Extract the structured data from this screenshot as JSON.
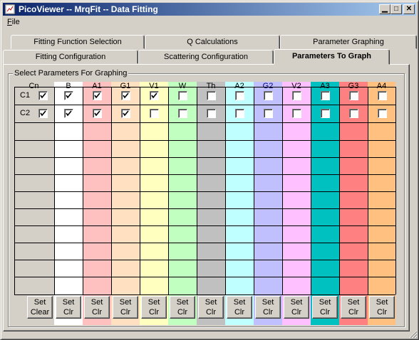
{
  "window": {
    "title": "PicoViewer -- MrqFit -- Data Fitting"
  },
  "menu": {
    "file_label_u": "F",
    "file_label_rest": "ile"
  },
  "tabs": {
    "row1": [
      {
        "label": "Fitting Function Selection"
      },
      {
        "label": "Q  Calculations"
      },
      {
        "label": "Parameter Graphing"
      }
    ],
    "row2": [
      {
        "label": "Fitting Configuration"
      },
      {
        "label": "Scattering Configuration"
      },
      {
        "label": "Parameters To Graph",
        "active": true
      }
    ]
  },
  "frame": {
    "label": "Select Parameters For Graphing"
  },
  "rows": {
    "labels": [
      "C1",
      "C2"
    ]
  },
  "columns": [
    {
      "name": "Cn",
      "color": "#d4d0c8",
      "header_color": "#000000",
      "btn_top": "Set",
      "btn_bottom": "Clear",
      "checked": [
        true,
        true
      ]
    },
    {
      "name": "B",
      "color": "#ffffff",
      "header_color": "#000000",
      "btn_top": "Set",
      "btn_bottom": "Clr",
      "checked": [
        true,
        true
      ]
    },
    {
      "name": "A1",
      "color": "#ffc0c0",
      "header_color": "#000000",
      "btn_top": "Set",
      "btn_bottom": "Clr",
      "checked": [
        true,
        true
      ]
    },
    {
      "name": "G1",
      "color": "#ffe0c0",
      "header_color": "#000000",
      "btn_top": "Set",
      "btn_bottom": "Clr",
      "checked": [
        true,
        true
      ]
    },
    {
      "name": "V1",
      "color": "#ffffc0",
      "header_color": "#000000",
      "btn_top": "Set",
      "btn_bottom": "Clr",
      "checked": [
        true,
        false
      ]
    },
    {
      "name": "W",
      "color": "#c0ffc0",
      "header_color": "#000000",
      "btn_top": "Set",
      "btn_bottom": "Clr",
      "checked": [
        false,
        false
      ]
    },
    {
      "name": "Th",
      "color": "#c0c0c0",
      "header_color": "#000000",
      "btn_top": "Set",
      "btn_bottom": "Clr",
      "checked": [
        false,
        false
      ]
    },
    {
      "name": "A2",
      "color": "#c0ffff",
      "header_color": "#000000",
      "btn_top": "Set",
      "btn_bottom": "Clr",
      "checked": [
        false,
        false
      ]
    },
    {
      "name": "G2",
      "color": "#c0c0ff",
      "header_color": "#000080",
      "btn_top": "Set",
      "btn_bottom": "Clr",
      "checked": [
        false,
        false
      ]
    },
    {
      "name": "V2",
      "color": "#ffc0ff",
      "header_color": "#000000",
      "btn_top": "Set",
      "btn_bottom": "Clr",
      "checked": [
        false,
        false
      ]
    },
    {
      "name": "A3",
      "color": "#00c0c0",
      "header_color": "#000000",
      "btn_top": "Set",
      "btn_bottom": "Clr",
      "checked": [
        false,
        false
      ]
    },
    {
      "name": "G3",
      "color": "#ff8080",
      "header_color": "#000000",
      "btn_top": "Set",
      "btn_bottom": "Clr",
      "checked": [
        false,
        false
      ]
    },
    {
      "name": "A4",
      "color": "#ffc080",
      "header_color": "#000000",
      "btn_top": "Set",
      "btn_bottom": "Clr",
      "checked": [
        false,
        false
      ]
    }
  ]
}
